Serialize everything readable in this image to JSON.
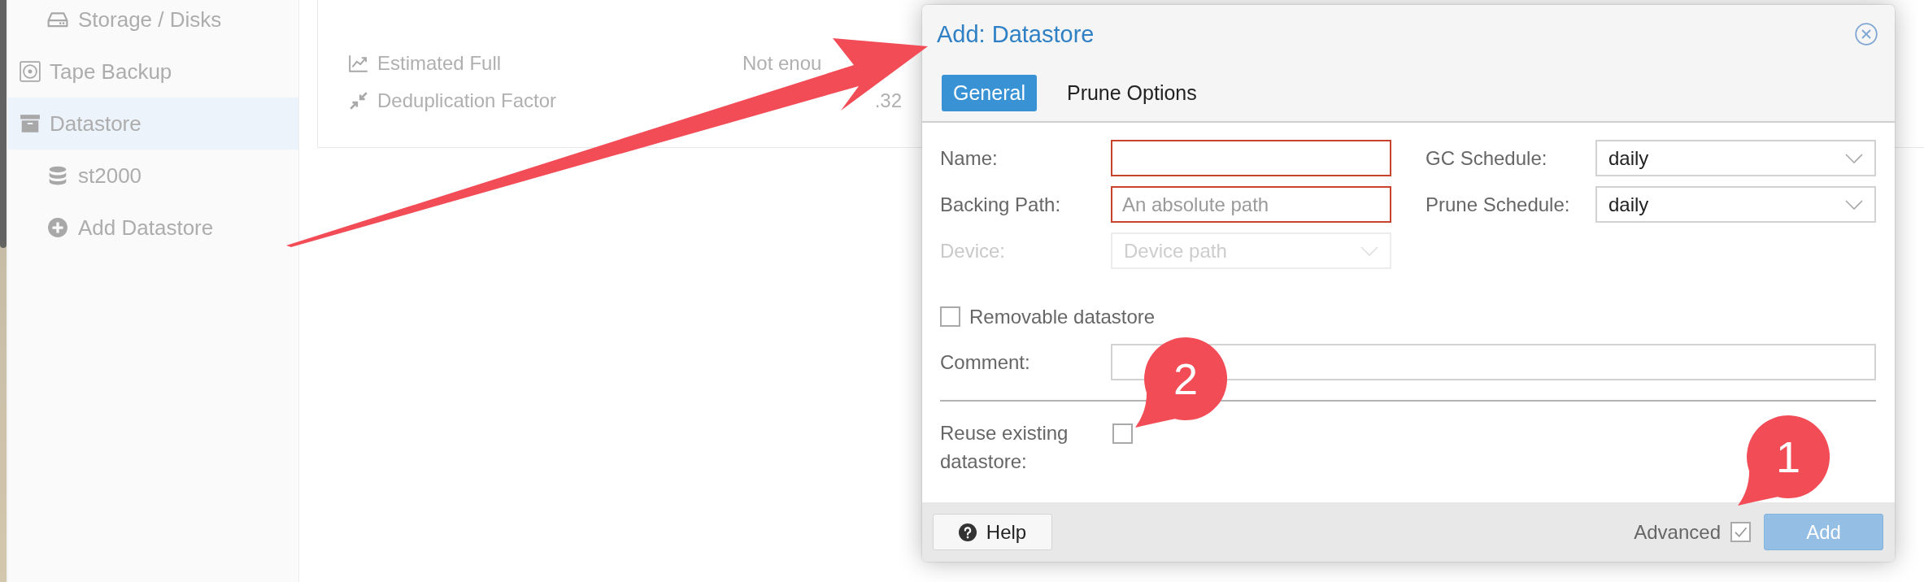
{
  "sidebar": {
    "cut_off_children": [
      {
        "label": "Storage / Disks",
        "selected": false
      }
    ],
    "items": [
      {
        "label": "Tape Backup",
        "selected": false
      },
      {
        "label": "Datastore",
        "selected": true,
        "children": [
          {
            "label": "st2000",
            "selected": false
          },
          {
            "label": "Add Datastore",
            "selected": false
          }
        ]
      }
    ]
  },
  "summary": {
    "rows": [
      {
        "label": "Estimated Full",
        "value": "Not enou"
      },
      {
        "label": "Deduplication Factor",
        "value": ".32"
      }
    ]
  },
  "dialog": {
    "title": "Add: Datastore",
    "tabs": [
      {
        "label": "General",
        "selected": true
      },
      {
        "label": "Prune Options",
        "selected": false
      }
    ],
    "left_column": [
      {
        "kind": "text",
        "label": "Name:",
        "invalid": true,
        "disabled": false
      },
      {
        "kind": "text",
        "label": "Backing Path:",
        "placeholder": "An absolute path",
        "invalid": true,
        "disabled": false
      },
      {
        "kind": "combo",
        "label": "Device:",
        "placeholder": "Device path",
        "invalid": false,
        "disabled": true
      }
    ],
    "right_column": [
      {
        "kind": "combo",
        "label": "GC Schedule:",
        "value": "daily",
        "invalid": false,
        "disabled": false
      },
      {
        "kind": "combo",
        "label": "Prune Schedule:",
        "value": "daily",
        "invalid": false,
        "disabled": false
      }
    ],
    "removable": {
      "label": "Removable datastore",
      "checked": false
    },
    "comment": {
      "label": "Comment:",
      "invalid": false
    },
    "reuse": {
      "label": "Reuse existing datastore:",
      "checked": false
    },
    "footer": {
      "help_button": {
        "label": "Help"
      },
      "advanced": {
        "label": "Advanced",
        "checked": true
      },
      "add_button": {
        "label": "Add",
        "disabled": true
      }
    }
  },
  "callouts": [
    {
      "number": "2"
    },
    {
      "number": "1"
    }
  ]
}
